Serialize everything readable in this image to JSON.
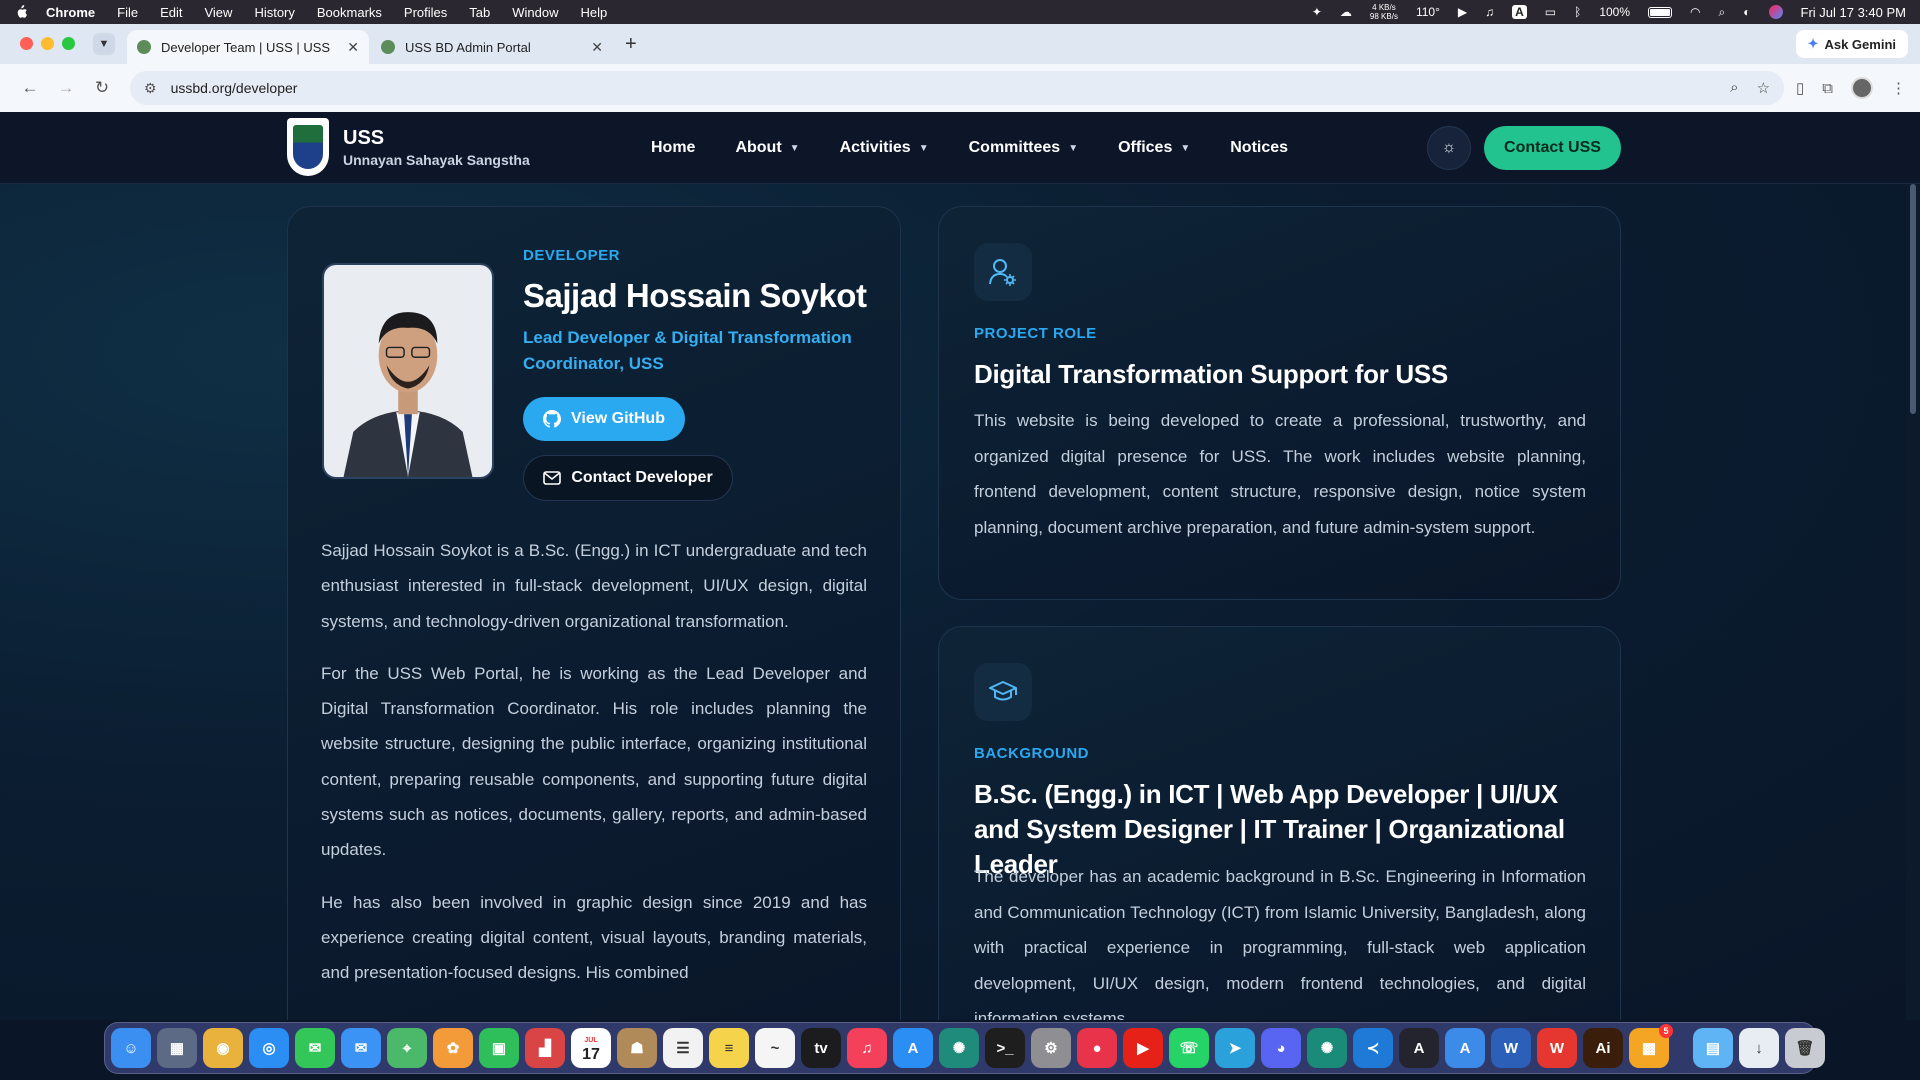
{
  "menubar": {
    "app": "Chrome",
    "items": [
      "File",
      "Edit",
      "View",
      "History",
      "Bookmarks",
      "Profiles",
      "Tab",
      "Window",
      "Help"
    ],
    "net_up": "4 KB/s",
    "net_down": "98 KB/s",
    "temp": "110°",
    "battery": "100%",
    "datetime": "Fri Jul 17  3:40 PM"
  },
  "tabs": [
    {
      "title": "Developer Team | USS | USS",
      "active": true
    },
    {
      "title": "USS BD Admin Portal",
      "active": false
    }
  ],
  "gemini_label": "Ask Gemini",
  "url": "ussbd.org/developer",
  "site": {
    "brand_title": "USS",
    "brand_subtitle": "Unnayan Sahayak Sangstha",
    "nav": [
      {
        "label": "Home",
        "dropdown": false
      },
      {
        "label": "About",
        "dropdown": true
      },
      {
        "label": "Activities",
        "dropdown": true
      },
      {
        "label": "Committees",
        "dropdown": true
      },
      {
        "label": "Offices",
        "dropdown": true
      },
      {
        "label": "Notices",
        "dropdown": false
      }
    ],
    "contact_label": "Contact USS"
  },
  "developer": {
    "eyebrow": "DEVELOPER",
    "name": "Sajjad Hossain Soykot",
    "title": "Lead Developer & Digital Transformation Coordinator, USS",
    "github_label": "View GitHub",
    "contact_label": "Contact Developer",
    "bio": [
      "Sajjad Hossain Soykot is a B.Sc. (Engg.) in ICT undergraduate and tech enthusiast interested in full-stack development, UI/UX design, digital systems, and technology-driven organizational transformation.",
      "For the USS Web Portal, he is working as the Lead Developer and Digital Transformation Coordinator. His role includes planning the website structure, designing the public interface, organizing institutional content, preparing reusable components, and supporting future digital systems such as notices, documents, gallery, reports, and admin-based updates.",
      "He has also been involved in graphic design since 2019 and has experience creating digital content, visual layouts, branding materials, and presentation-focused designs. His combined"
    ]
  },
  "project_role": {
    "icon": "user-gear-icon",
    "eyebrow": "PROJECT ROLE",
    "heading": "Digital Transformation Support for USS",
    "body": "This website is being developed to create a professional, trustworthy, and organized digital presence for USS. The work includes website planning, frontend development, content structure, responsive design, notice system planning, document archive preparation, and future admin-system support."
  },
  "background": {
    "icon": "graduation-cap-icon",
    "eyebrow": "BACKGROUND",
    "heading": "B.Sc. (Engg.) in ICT | Web App Developer | UI/UX and System Designer | IT Trainer | Organizational Leader",
    "body": "The developer has an academic background in B.Sc. Engineering in Information and Communication Technology (ICT) from Islamic University, Bangladesh, along with practical experience in programming, full-stack web application development, UI/UX design, modern frontend technologies, and digital information systems."
  },
  "dock": {
    "calendar_day": "17",
    "calendar_month": "JUL",
    "badge": "5",
    "apps": [
      {
        "name": "finder-icon",
        "color": "#3b8ff0"
      },
      {
        "name": "launchpad-icon",
        "color": "#5c6a86"
      },
      {
        "name": "chrome-icon",
        "color": "#e9b23c"
      },
      {
        "name": "safari-icon",
        "color": "#2a8ef5"
      },
      {
        "name": "messages-icon",
        "color": "#33c759"
      },
      {
        "name": "mail-icon",
        "color": "#3a93f5"
      },
      {
        "name": "maps-icon",
        "color": "#4cb86a"
      },
      {
        "name": "photos-icon",
        "color": "#f29b38"
      },
      {
        "name": "facetime-icon",
        "color": "#2fbf5a"
      },
      {
        "name": "toolbox-icon",
        "color": "#d94444"
      },
      {
        "name": "calendar-icon",
        "color": "#ffffff"
      },
      {
        "name": "contacts-icon",
        "color": "#b08a58"
      },
      {
        "name": "reminders-icon",
        "color": "#f2f2f2"
      },
      {
        "name": "notes-icon",
        "color": "#f5d34a"
      },
      {
        "name": "freeform-icon",
        "color": "#f5f5f5"
      },
      {
        "name": "appletv-icon",
        "color": "#1c1c1e"
      },
      {
        "name": "music-icon",
        "color": "#f5405c"
      },
      {
        "name": "appstore-icon",
        "color": "#2a8ef5"
      },
      {
        "name": "chatgpt-icon",
        "color": "#1f8b7a"
      },
      {
        "name": "terminal-icon",
        "color": "#1e1e1e"
      },
      {
        "name": "settings-icon",
        "color": "#8e8e93"
      },
      {
        "name": "cast-icon",
        "color": "#e8334a"
      },
      {
        "name": "youtube-icon",
        "color": "#e62117"
      },
      {
        "name": "whatsapp-icon",
        "color": "#25d366"
      },
      {
        "name": "telegram-icon",
        "color": "#2aa1da"
      },
      {
        "name": "discord-icon",
        "color": "#5865f2"
      },
      {
        "name": "openai-icon",
        "color": "#1a8b78"
      },
      {
        "name": "vscode-icon",
        "color": "#1e7ad6"
      },
      {
        "name": "affinity-icon",
        "color": "#23242e"
      },
      {
        "name": "designer-icon",
        "color": "#3c8be8"
      },
      {
        "name": "word-icon",
        "color": "#2b5fb8"
      },
      {
        "name": "wps-icon",
        "color": "#e5372f"
      },
      {
        "name": "illustrator-icon",
        "color": "#3a1d0a"
      },
      {
        "name": "office-icon",
        "color": "#f4a524"
      },
      {
        "name": "folder-icon",
        "color": "#5fb4f5"
      },
      {
        "name": "downloads-icon",
        "color": "#e8edf3"
      },
      {
        "name": "trash-icon",
        "color": "#c8ccd2"
      }
    ]
  },
  "colors": {
    "accent_blue": "#2aa8f0",
    "accent_green": "#22c38e",
    "page_bg": "#0b1a2e"
  }
}
